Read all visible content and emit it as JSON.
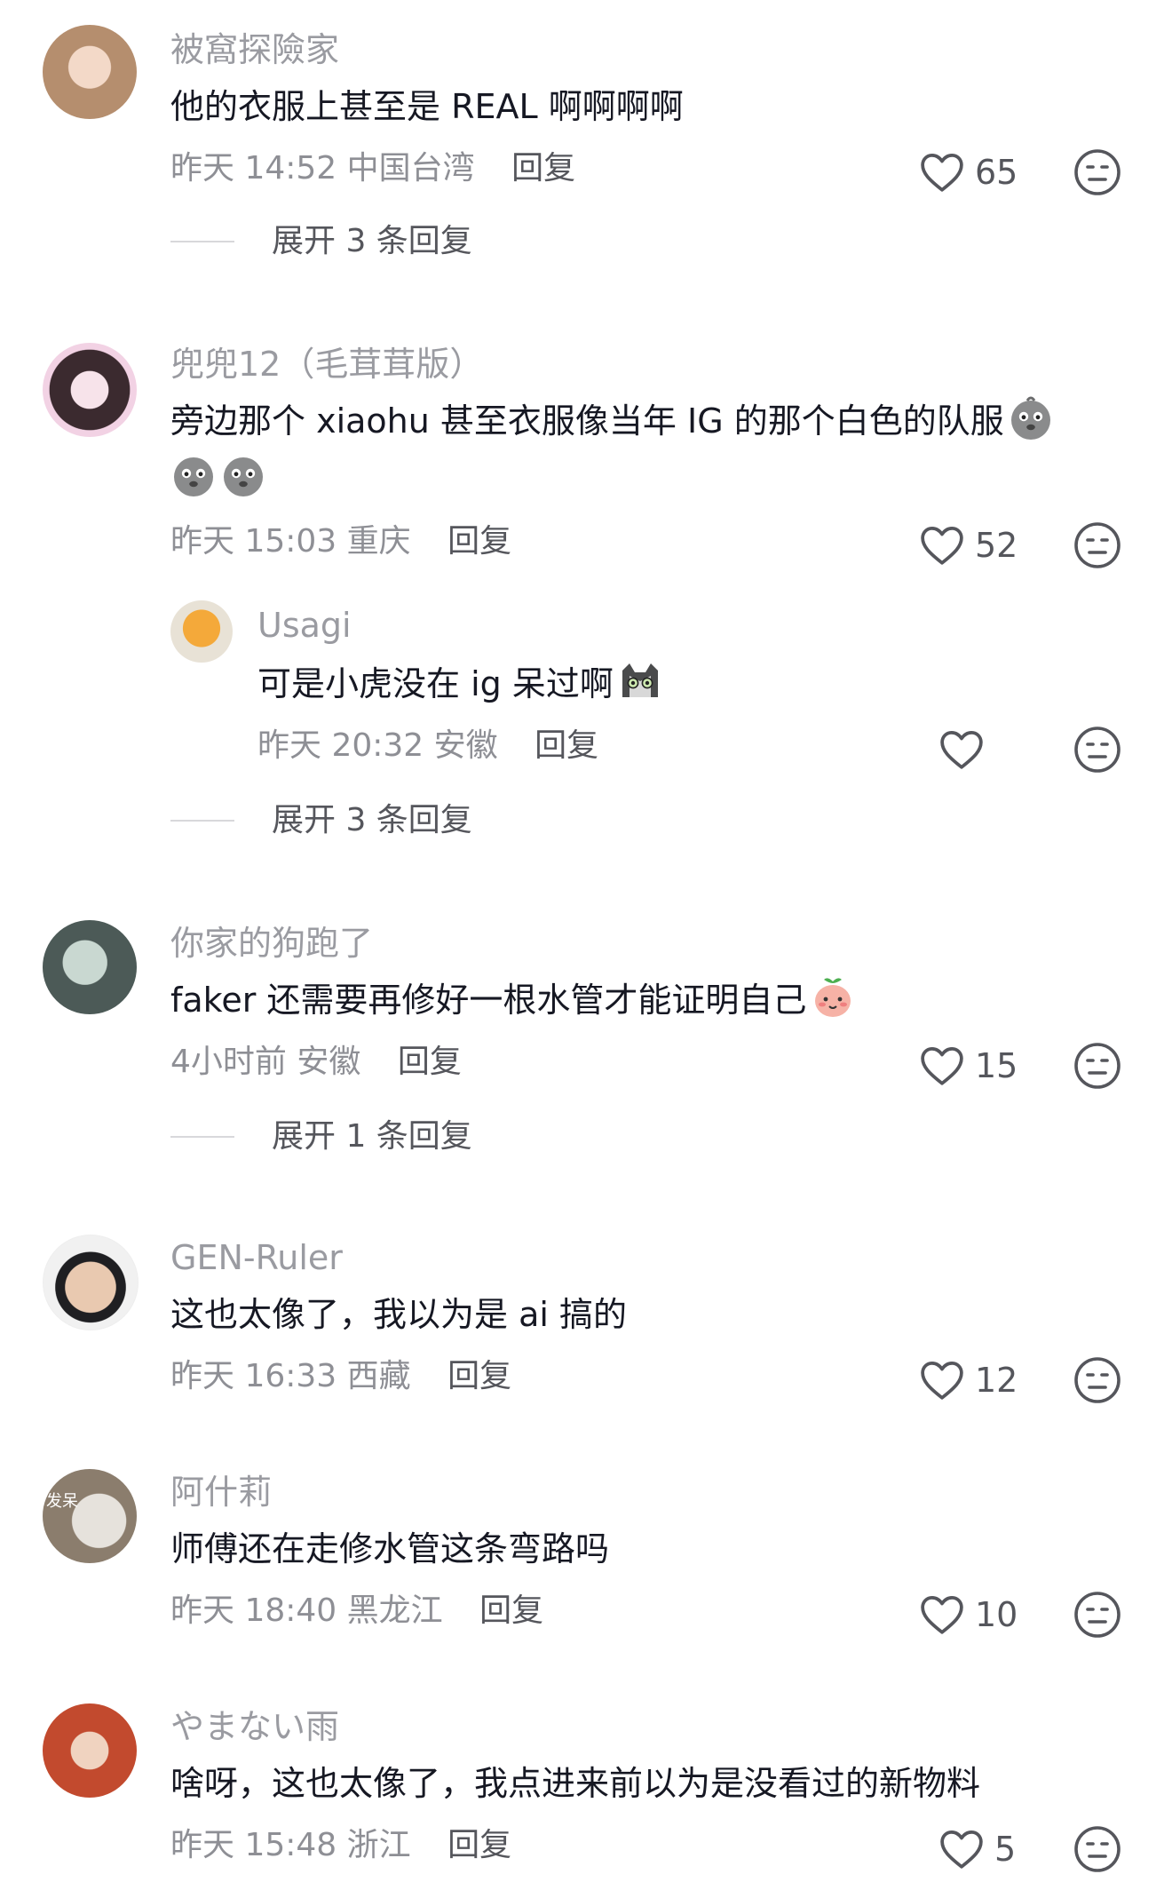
{
  "comments": [
    {
      "username": "被窩探險家",
      "text": "他的衣服上甚至是 REAL 啊啊啊啊",
      "time": "昨天 14:52",
      "location": "中国台湾",
      "reply_label": "回复",
      "likes": "65",
      "expand_label": "展开 3 条回复"
    },
    {
      "username": "兜兜12（毛茸茸版）",
      "text_line1": "旁边那个 xiaohu 甚至衣服像当年 IG 的那个白色的队服",
      "time": "昨天 15:03",
      "location": "重庆",
      "reply_label": "回复",
      "likes": "52",
      "emoji": "crying-face-emoji"
    },
    {
      "username": "你家的狗跑了",
      "text": "faker 还需要再修好一根水管才能证明自己",
      "time": "4小时前",
      "location": "安徽",
      "reply_label": "回复",
      "likes": "15",
      "expand_label": "展开 1 条回复",
      "emoji": "blushing-fruit-emoji"
    },
    {
      "username": "GEN-Ruler",
      "text": "这也太像了，我以为是 ai 搞的",
      "time": "昨天 16:33",
      "location": "西藏",
      "reply_label": "回复",
      "likes": "12"
    },
    {
      "username": "阿什莉",
      "text": "师傅还在走修水管这条弯路吗",
      "time": "昨天 18:40",
      "location": "黑龙江",
      "reply_label": "回复",
      "likes": "10",
      "avatar_text": "发呆"
    },
    {
      "username": "やまない雨",
      "text": "啥呀，这也太像了，我点进来前以为是没看过的新物料",
      "time": "昨天 15:48",
      "location": "浙江",
      "reply_label": "回复",
      "likes": "5"
    }
  ],
  "nested_reply": {
    "username": "Usagi",
    "text": "可是小虎没在 ig 呆过啊",
    "time": "昨天 20:32",
    "location": "安徽",
    "reply_label": "回复",
    "likes": "",
    "expand_label": "展开 3 条回复",
    "emoji": "cat-emoji"
  },
  "icons": {
    "like": "heart-outline-icon",
    "dislike": "neutral-face-icon"
  },
  "colors": {
    "username": "#9a9ba1",
    "text": "#161823",
    "meta": "#8e8f95",
    "icon": "#55565c"
  }
}
